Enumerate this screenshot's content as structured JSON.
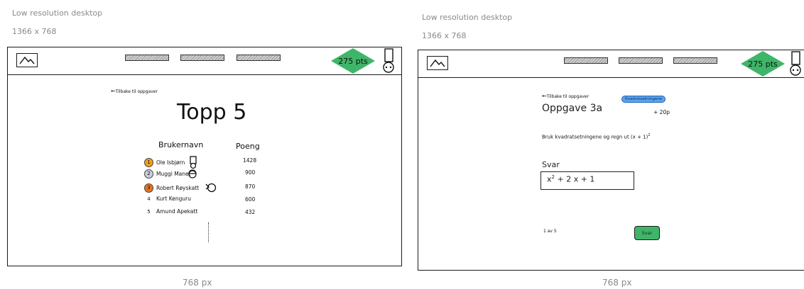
{
  "panel_left": {
    "meta_title": "Low resolution desktop",
    "meta_size": "1366 x 768",
    "footer_px": "768 px",
    "header": {
      "points": "275 pts"
    },
    "back_link": "Tilbake til oppgaver",
    "title": "Topp 5",
    "columns": {
      "username": "Brukernavn",
      "score": "Poeng"
    },
    "rows": [
      {
        "rank": "1",
        "name": "Ole Isbjørn",
        "score": "1428",
        "medal_color": "#f0a020"
      },
      {
        "rank": "2",
        "name": "Muggi Manet",
        "score": "900",
        "medal_color": "#c9ccd8"
      },
      {
        "rank": "3",
        "name": "Robert Røyskatt",
        "score": "870",
        "medal_color": "#e8721e"
      },
      {
        "rank": "4",
        "name": "Kurt Kenguru",
        "score": "600"
      },
      {
        "rank": "5",
        "name": "Amund Apekatt",
        "score": "432"
      }
    ]
  },
  "panel_right": {
    "meta_title": "Low resolution desktop",
    "meta_size": "1366 x 768",
    "footer_px": "768 px",
    "header": {
      "points": "275 pts"
    },
    "back_link": "Tilbake til oppgaver",
    "category_tag": "Kvadratsetningene",
    "task_title": "Oppgave 3a",
    "reward": "+ 20p",
    "instruction": "Bruk kvadratsetningene og regn ut (x + 1)",
    "instruction_exp": "2",
    "answer_label": "Svar",
    "answer_value_pre": "x",
    "answer_value_exp": "2",
    "answer_value_post": " + 2 x + 1",
    "progress": "1 av 5",
    "submit_label": "Svar"
  },
  "colors": {
    "points_green": "#3fb569",
    "tag_blue": "#5aa6f0"
  }
}
